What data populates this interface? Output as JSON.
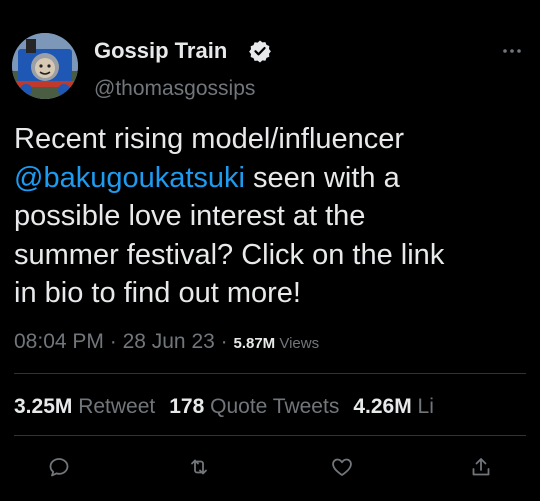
{
  "author": {
    "display_name": "Gossip Train",
    "handle": "@thomasgossips",
    "avatar_icon": "train-engine-avatar",
    "verified": true
  },
  "tweet": {
    "lines": [
      "Recent rising model/influencer",
      " seen with a",
      "possible love interest at the",
      "summer festival? Click on the link",
      "in bio to find out more!"
    ],
    "mention": "@bakugoukatsuki"
  },
  "meta": {
    "time": "08:04 PM",
    "sep1": " · ",
    "date": "28 Jun 23",
    "sep2": " · ",
    "views_count": "5.87M",
    "views_label": " Views"
  },
  "stats": {
    "retweets_count": "3.25M",
    "retweets_label": " Retweet",
    "quotes_count": "178",
    "quotes_label": " Quote Tweets",
    "likes_count": "4.26M",
    "likes_label": " Li"
  },
  "colors": {
    "background": "#000000",
    "text": "#e7e9ea",
    "muted": "#71767b",
    "accent": "#1d9bf0",
    "divider": "#2f3336"
  },
  "icons": {
    "more": "more-horizontal-icon",
    "reply": "reply-icon",
    "retweet": "retweet-icon",
    "like": "heart-icon",
    "share": "share-icon",
    "verified": "verified-badge-icon"
  }
}
